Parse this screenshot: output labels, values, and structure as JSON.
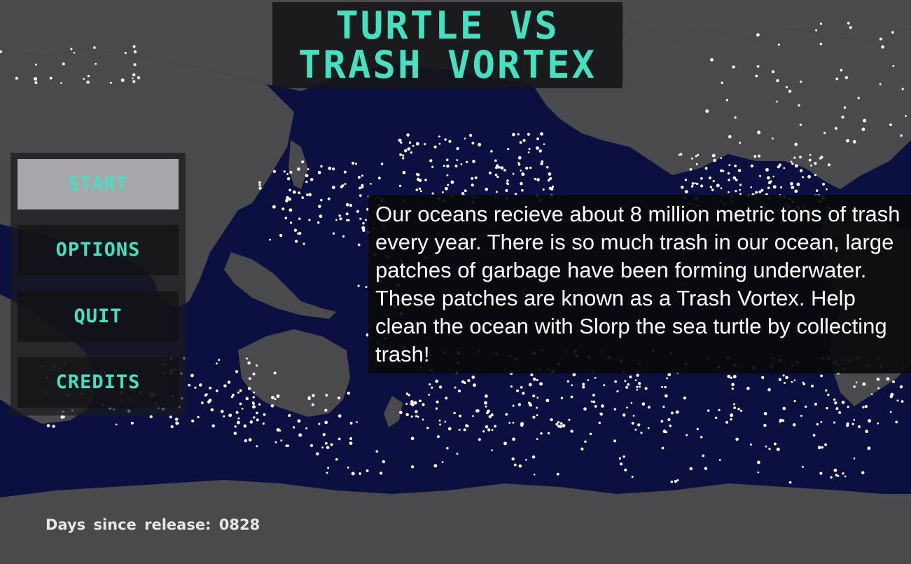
{
  "game": {
    "title_line_1": "TURTLE VS",
    "title_line_2": "TRASH VORTEX"
  },
  "menu": {
    "items": [
      {
        "label": "START",
        "selected": true
      },
      {
        "label": "OPTIONS",
        "selected": false
      },
      {
        "label": "QUIT",
        "selected": false
      },
      {
        "label": "CREDITS",
        "selected": false
      }
    ]
  },
  "info": {
    "text": "Our oceans recieve about 8 million metric tons of trash every year. There is so much trash in our ocean, large patches of garbage have been forming underwater. These patches are known as a Trash Vortex. Help clean the ocean with Slorp the sea turtle by collecting trash!"
  },
  "footer": {
    "release_label": "Days since release:",
    "release_days": "0828"
  },
  "colors": {
    "ocean": "#0b1040",
    "land": "#4a4a4a",
    "accent": "#45e0c0",
    "trash": "#ffffff",
    "selected_button": "#a9a6ac"
  },
  "icons": {
    "background": "world-map",
    "trash_particles": "trash-dot"
  }
}
